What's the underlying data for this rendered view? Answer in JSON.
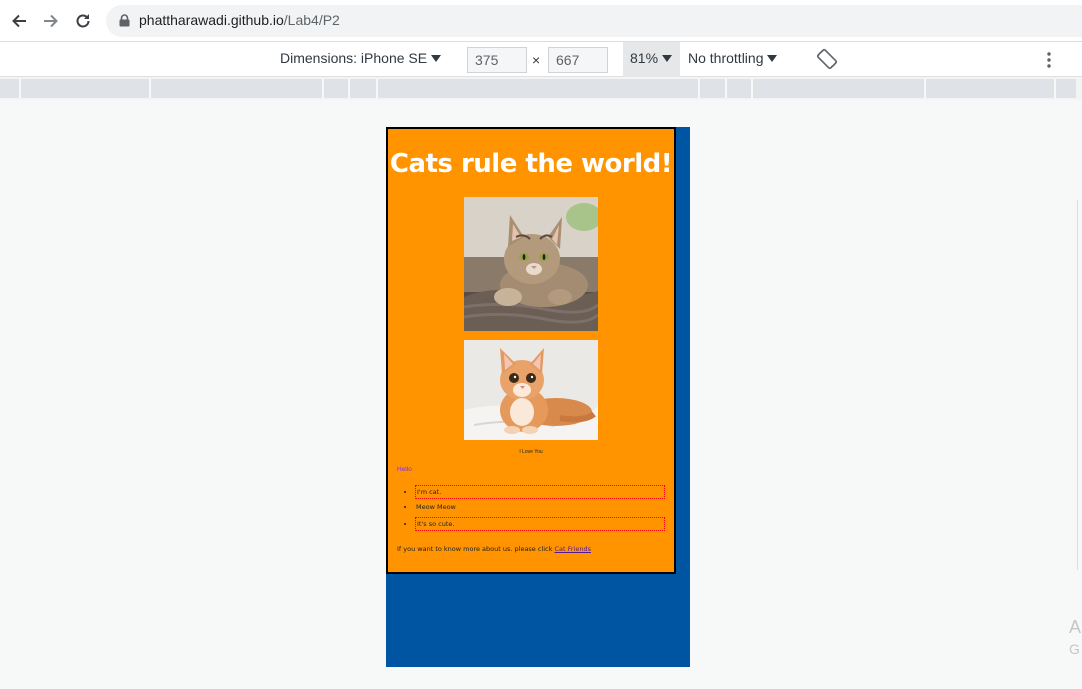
{
  "browser": {
    "url_host": "phattharawadi.github.io",
    "url_path": "/Lab4/P2"
  },
  "device_toolbar": {
    "dimensions_label": "Dimensions: iPhone SE",
    "width": "375",
    "times": "×",
    "height": "667",
    "zoom": "81%",
    "throttling": "No throttling"
  },
  "page": {
    "title": "Cats rule the world!",
    "caption": "I Love You",
    "hello": "Hello",
    "list": [
      "I'm cat.",
      "Meow Meow",
      "It's so cute."
    ],
    "footer_text": "If you want to know more about us. please click",
    "footer_link": "Cat Friends"
  },
  "side": {
    "letter1": "A",
    "letter2": "G"
  },
  "colors": {
    "page_bg": "#ff9400",
    "viewport_bg": "#0055a2",
    "title": "#ffffff"
  }
}
